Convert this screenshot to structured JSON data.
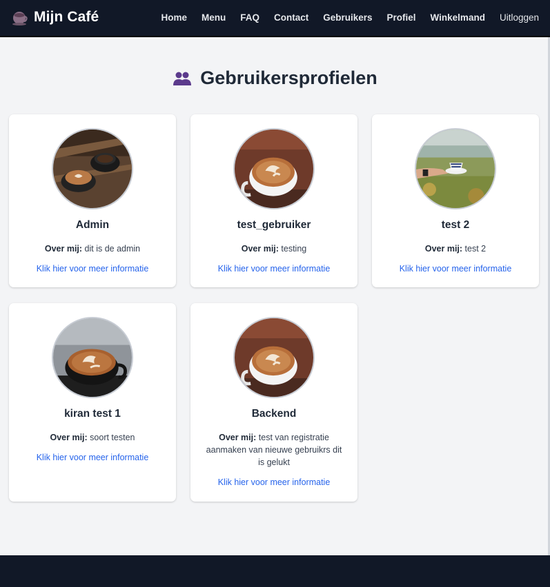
{
  "nav": {
    "brand": "Mijn Café",
    "links": [
      "Home",
      "Menu",
      "FAQ",
      "Contact",
      "Gebruikers",
      "Profiel",
      "Winkelmand",
      "Uitloggen"
    ]
  },
  "page": {
    "title": "Gebruikersprofielen"
  },
  "about_label": "Over mij:",
  "users": [
    {
      "name": "Admin",
      "about": "dit is de admin",
      "link": "Klik hier voor meer informatie"
    },
    {
      "name": "test_gebruiker",
      "about": "testing",
      "link": "Klik hier voor meer informatie"
    },
    {
      "name": "test 2",
      "about": "test 2",
      "link": "Klik hier voor meer informatie"
    },
    {
      "name": "kiran test 1",
      "about": "soort testen",
      "link": "Klik hier voor meer informatie"
    },
    {
      "name": "Backend",
      "about": "test van registratie aanmaken van nieuwe gebruikrs dit is gelukt",
      "link": "Klik hier voor meer informatie"
    }
  ],
  "colors": {
    "nav_bg": "#111827",
    "page_bg": "#f3f4f6",
    "link": "#2563eb",
    "title_icon": "#5b3a8c"
  },
  "icons": {
    "brand": "coffee-cup-icon",
    "title": "users-icon"
  }
}
